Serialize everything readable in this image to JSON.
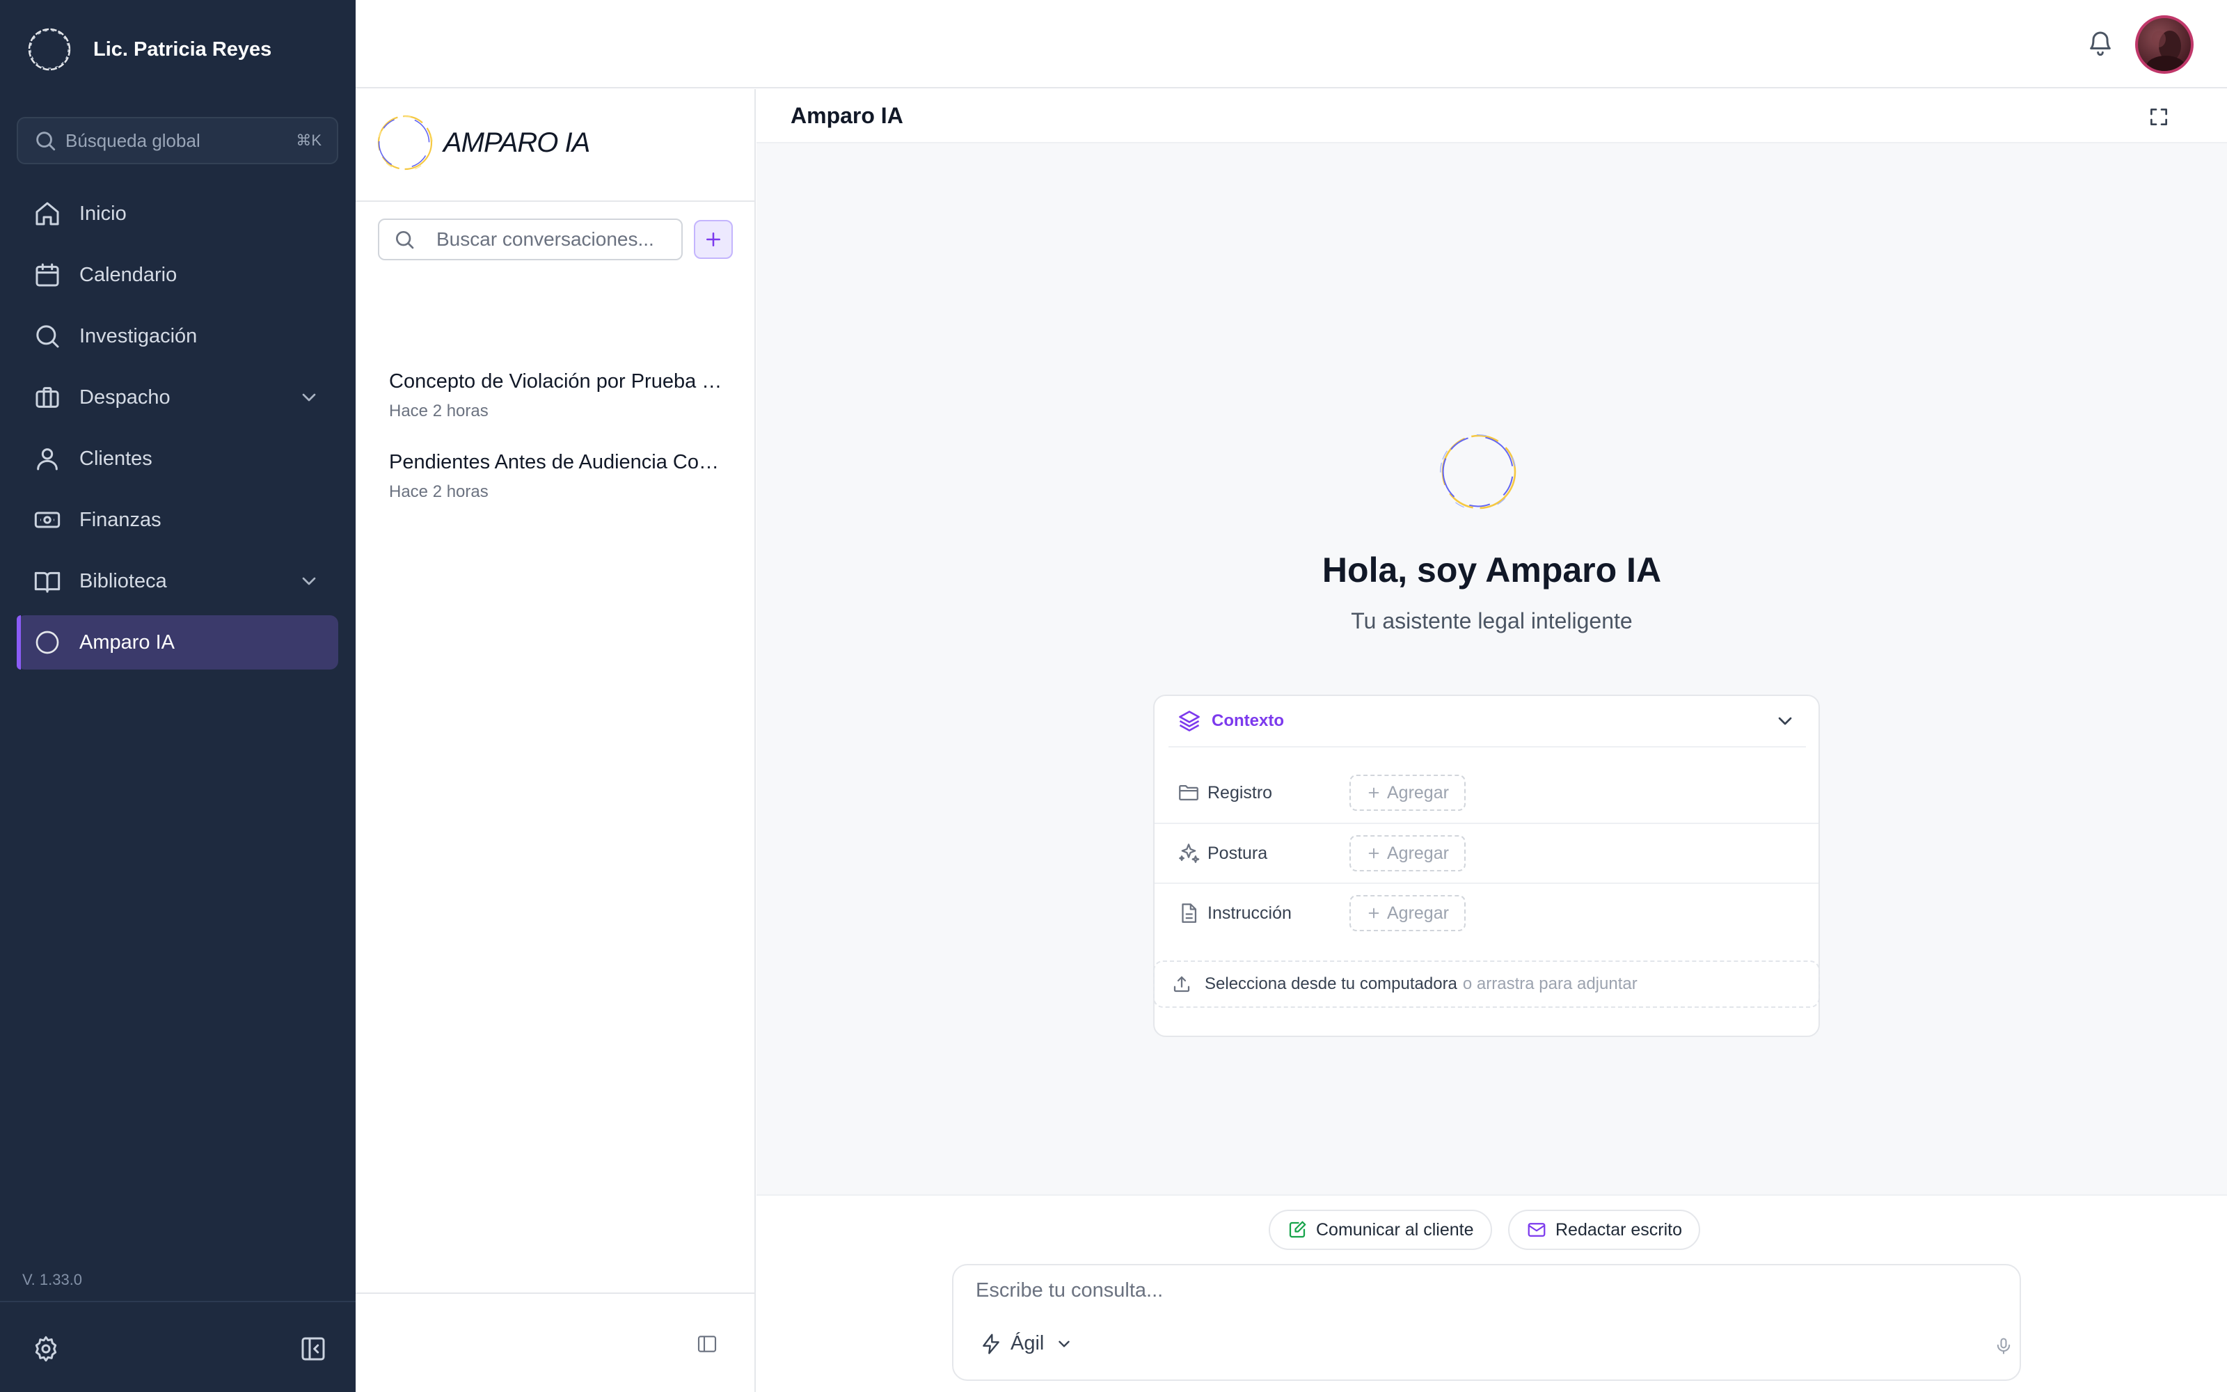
{
  "sidebar": {
    "user_name": "Lic. Patricia Reyes",
    "search": {
      "placeholder": "Búsqueda global",
      "shortcut": "⌘K"
    },
    "items": [
      {
        "label": "Inicio",
        "icon": "home-icon"
      },
      {
        "label": "Calendario",
        "icon": "calendar-icon"
      },
      {
        "label": "Investigación",
        "icon": "search-icon"
      },
      {
        "label": "Despacho",
        "icon": "briefcase-icon",
        "expandable": true
      },
      {
        "label": "Clientes",
        "icon": "user-icon"
      },
      {
        "label": "Finanzas",
        "icon": "banknote-icon"
      },
      {
        "label": "Biblioteca",
        "icon": "book-icon",
        "expandable": true
      },
      {
        "label": "Amparo IA",
        "icon": "amparo-ring-icon",
        "active": true
      }
    ],
    "version": "V. 1.33.0"
  },
  "conversations": {
    "logo_text": "AMPARO IA",
    "search_placeholder": "Buscar conversaciones...",
    "items": [
      {
        "title": "Concepto de Violación por Prueba Ilícita",
        "time": "Hace 2 horas"
      },
      {
        "title": "Pendientes Antes de Audiencia Constitucional",
        "time": "Hace 2 horas"
      }
    ]
  },
  "chat": {
    "title": "Amparo IA",
    "greeting": "Hola, soy Amparo IA",
    "subtitle": "Tu asistente legal inteligente",
    "context": {
      "label": "Contexto",
      "rows": [
        {
          "label": "Registro",
          "add": "Agregar"
        },
        {
          "label": "Postura",
          "add": "Agregar"
        },
        {
          "label": "Instrucción",
          "add": "Agregar"
        }
      ]
    },
    "attach": {
      "primary": "Selecciona desde tu computadora",
      "secondary": "o arrastra para adjuntar"
    },
    "quick_actions": [
      {
        "label": "Comunicar al cliente"
      },
      {
        "label": "Redactar escrito"
      }
    ],
    "composer": {
      "placeholder": "Escribe tu consulta...",
      "mode": "Ágil"
    }
  },
  "colors": {
    "sidebar_bg": "#1e2a3f",
    "active_item_bg": "#3b3a6b",
    "accent_purple": "#7c3aed",
    "ring_yellow": "#f5c842",
    "ring_indigo": "#6366f1",
    "action_green": "#16a34a"
  }
}
